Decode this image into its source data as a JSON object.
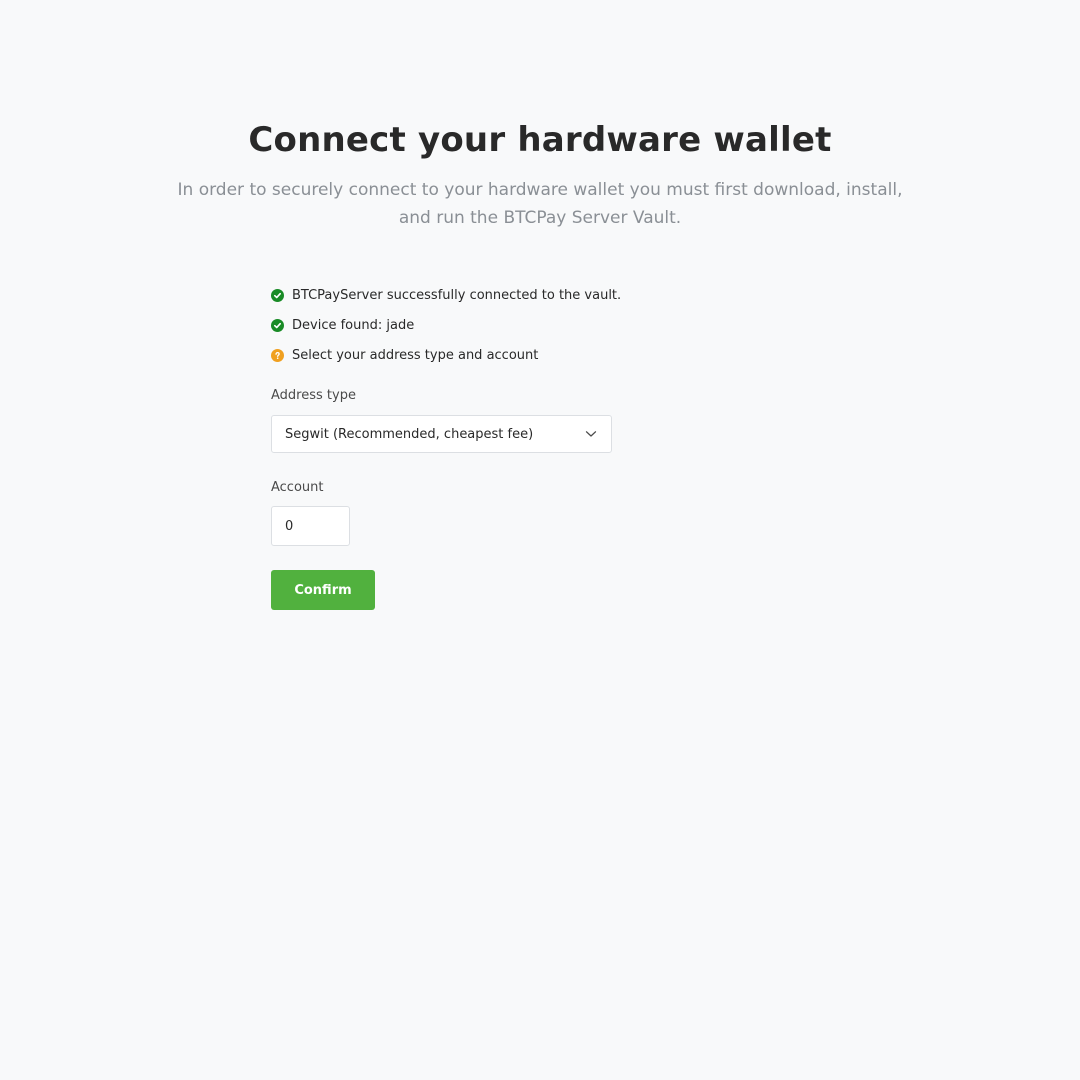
{
  "header": {
    "title": "Connect your hardware wallet",
    "lead": "In order to securely connect to your hardware wallet you must first download, install, and run the BTCPay Server Vault."
  },
  "status": {
    "items": [
      {
        "text": "BTCPayServer successfully connected to the vault.",
        "state": "success",
        "icon": "check-circle-icon"
      },
      {
        "text": "Device found: jade",
        "state": "success",
        "icon": "check-circle-icon"
      },
      {
        "text": "Select your address type and account",
        "state": "pending",
        "icon": "question-circle-icon"
      }
    ]
  },
  "form": {
    "address_type_label": "Address type",
    "address_type_value": "Segwit (Recommended, cheapest fee)",
    "account_label": "Account",
    "account_value": "0",
    "confirm_label": "Confirm"
  },
  "colors": {
    "background": "#f8f9fa",
    "success": "#198b26",
    "warning": "#f0a020",
    "primary_button": "#51b13e",
    "lead_text": "#8a8f95"
  }
}
